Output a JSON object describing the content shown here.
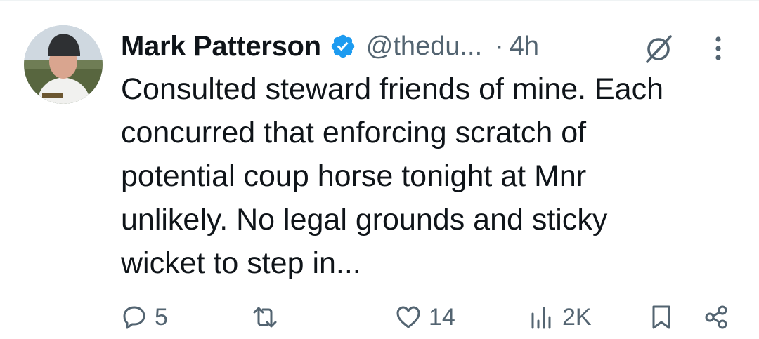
{
  "tweet": {
    "author_name": "Mark Patterson",
    "handle": "@thedu...",
    "separator": "·",
    "time": "4h",
    "text": "Consulted steward friends of mine. Each\nconcurred that enforcing scratch of\npotential coup horse tonight at Mnr\nunlikely. No legal grounds and sticky\nwicket to step in...",
    "verified": true,
    "accent_color": "#1d9bf0"
  },
  "actions": {
    "replies": "5",
    "reposts": "",
    "likes": "14",
    "views": "2K"
  },
  "icons": [
    "verified-badge-icon",
    "grok-icon",
    "more-icon",
    "reply-icon",
    "repost-icon",
    "like-icon",
    "views-icon",
    "bookmark-icon",
    "share-icon"
  ]
}
